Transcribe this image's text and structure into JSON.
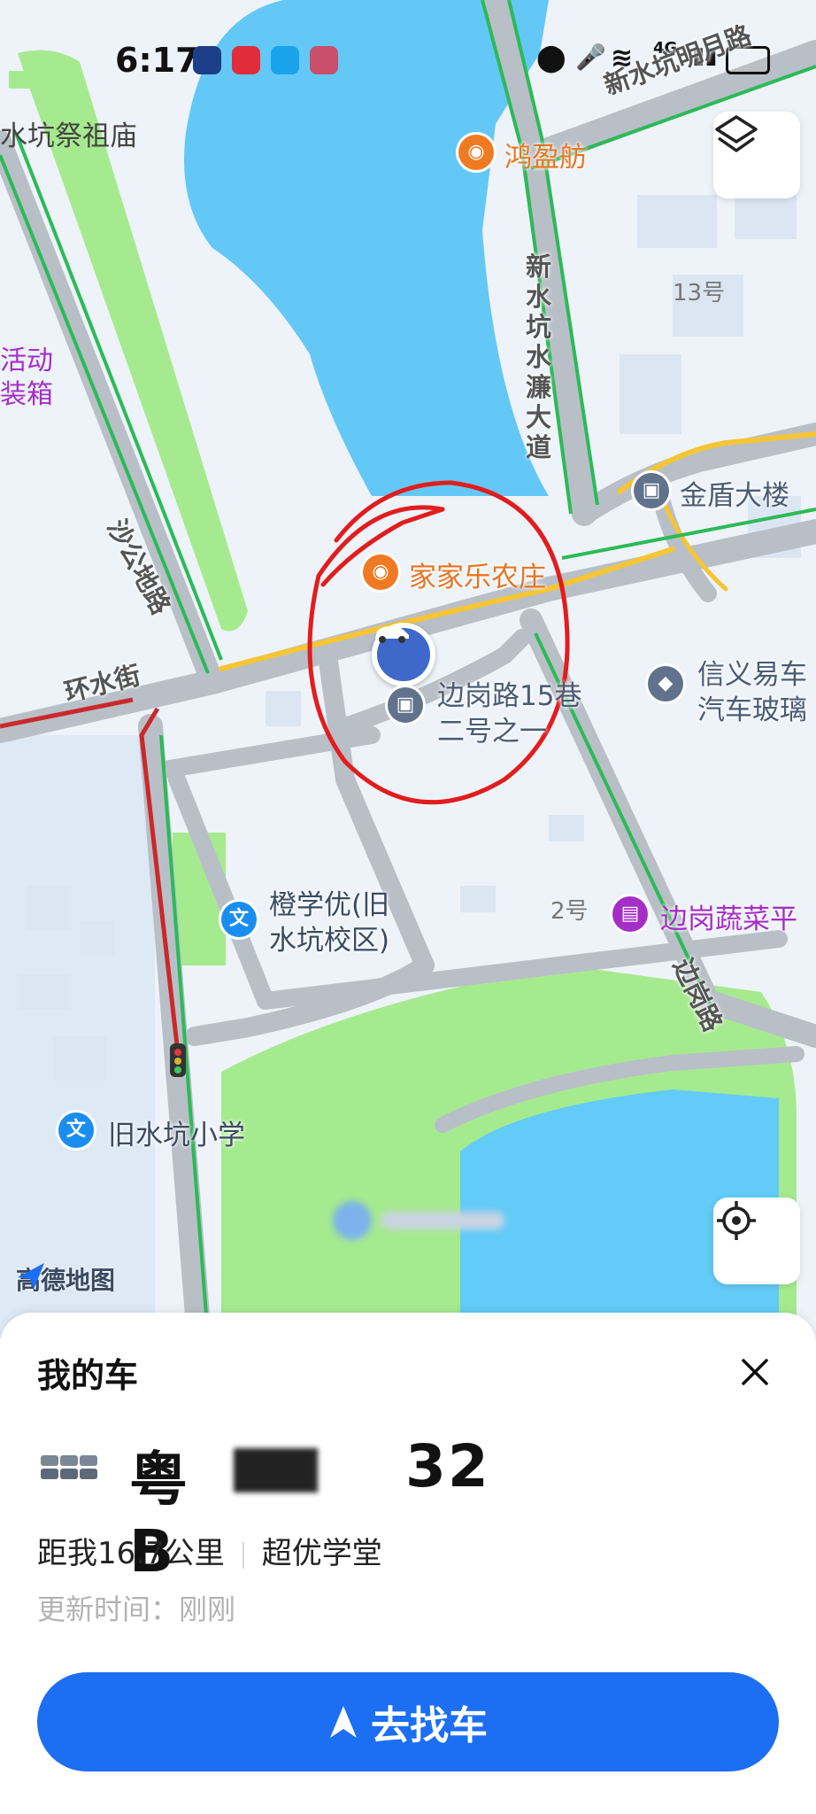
{
  "status_bar": {
    "time": "6:17",
    "network": "4G"
  },
  "map": {
    "roads": {
      "xinshuikeng_mingyue": "新水坑明月路",
      "xinshuikeng_shuilian": "新水坑水濂大道",
      "shagong": "沙公地路",
      "huanshui": "环水街",
      "biangang": "边岗路"
    },
    "pois": {
      "jizumiao": "水坑祭祖庙",
      "hongyingfang": "鸿盈舫",
      "huodong": "活动",
      "zhuangxiang": "装箱",
      "num13": "13号",
      "jindun": "金盾大楼",
      "jiajiale": "家家乐农庄",
      "bg15_line1": "边岗路15巷",
      "bg15_line2": "二号之一",
      "xinyi_line1": "信义易车",
      "xinyi_line2": "汽车玻璃",
      "chengxueyou_line1": "橙学优(旧",
      "chengxueyou_line2": "水坑校区)",
      "num2": "2号",
      "shucai": "边岗蔬菜平",
      "xiaoxue": "旧水坑小学"
    },
    "watermark": "高德地图"
  },
  "sheet": {
    "title": "我的车",
    "plate": "粤B",
    "plate_tail": "32",
    "distance": "距我16.7公里",
    "place": "超优学堂",
    "updated": "更新时间：刚刚",
    "button": "去找车"
  },
  "colors": {
    "accent": "#1c6ef2",
    "water": "#62c6f6",
    "park": "#a4e98c",
    "road": "#b8bec6"
  }
}
